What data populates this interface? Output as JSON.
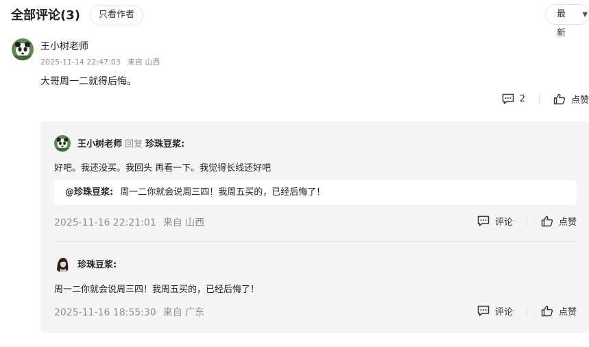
{
  "header": {
    "title": "全部评论(3)",
    "only_author": "只看作者",
    "sort": "最新"
  },
  "main_comment": {
    "author": "王小树老师",
    "time": "2025-11-14 22:47:03",
    "location": "来自 山西",
    "text": "大哥周一二就得后悔。",
    "reply_count": "2",
    "like_label": "点赞"
  },
  "replies": [
    {
      "author": "王小树老师",
      "reply_word": "回复",
      "reply_to": "珍珠豆浆:",
      "text": "好吧。我还没买。我回头 再看一下。我觉得长线还好吧",
      "quote_name": "@珍珠豆浆:",
      "quote_text": "周一二你就会说周三四！我周五买的，已经后悔了！",
      "time": "2025-11-16 22:21:01",
      "location": "来自 山西",
      "comment_label": "评论",
      "like_label": "点赞"
    },
    {
      "author": "珍珠豆浆:",
      "text": "周一二你就会说周三四！我周五买的，已经后悔了！",
      "time": "2025-11-16 18:55:30",
      "location": "来自 广东",
      "comment_label": "评论",
      "like_label": "点赞"
    }
  ],
  "icons": {
    "comment": "comment-bubble-icon",
    "like": "thumbs-up-icon",
    "sort": "chevron-down-icon"
  }
}
